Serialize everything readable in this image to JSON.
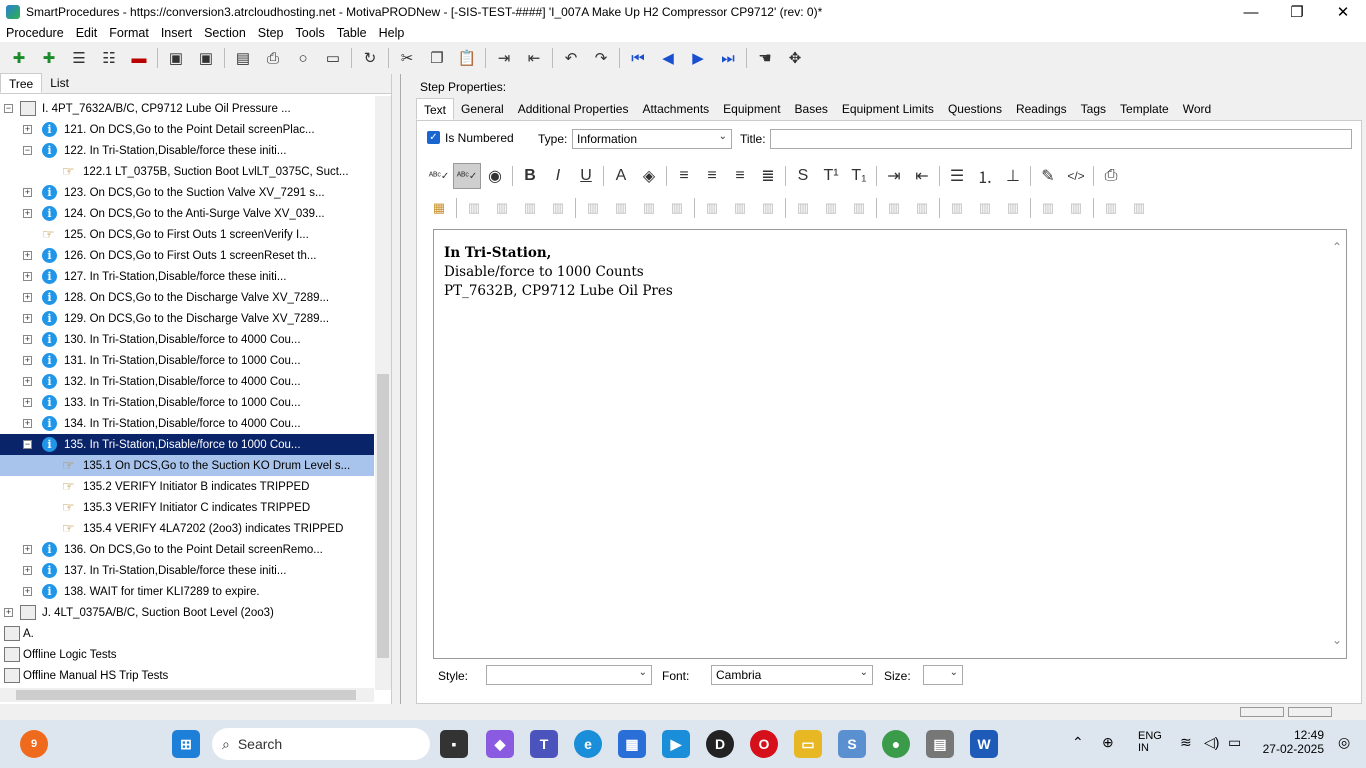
{
  "window": {
    "title": "SmartProcedures - https://conversion3.atrcloudhosting.net - MotivaPRODNew - [-SIS-TEST-####] 'I_007A Make Up H2 Compressor CP9712' (rev: 0)*",
    "min": "—",
    "max": "❐",
    "close": "✕"
  },
  "menu": [
    "Procedure",
    "Edit",
    "Format",
    "Insert",
    "Section",
    "Step",
    "Tools",
    "Table",
    "Help"
  ],
  "toolbar": [
    "add-icon",
    "add-child-icon",
    "list-icon",
    "list2-icon",
    "remove-icon",
    "save-all-icon",
    "save-icon",
    "export-icon",
    "print-icon",
    "refresh-icon",
    "frame-icon",
    "redo-icon",
    "cut-icon",
    "copy-icon",
    "paste-icon",
    "indent-icon",
    "outdent-icon",
    "undo-icon",
    "redo2-icon",
    "first-icon",
    "prev-icon",
    "next-icon",
    "last-icon",
    "hand-icon",
    "move-icon"
  ],
  "left_tabs": {
    "tree": "Tree",
    "list": "List"
  },
  "tree": [
    {
      "label": "I. 4PT_7632A/B/C, CP9712 Lube Oil Pressure ...",
      "lvl": 0,
      "exp": "⊟",
      "icon": "folder"
    },
    {
      "label": "121. On DCS,Go to the Point Detail screenPlac...",
      "lvl": 1,
      "exp": "+",
      "icon": "info"
    },
    {
      "label": "122. In Tri-Station,Disable/force these initi...",
      "lvl": 1,
      "exp": "−",
      "icon": "info"
    },
    {
      "label": "122.1 LT_0375B, Suction Boot LvlLT_0375C, Suct...",
      "lvl": 2,
      "exp": "",
      "icon": "hand"
    },
    {
      "label": "123. On DCS,Go to the Suction Valve XV_7291 s...",
      "lvl": 1,
      "exp": "+",
      "icon": "info"
    },
    {
      "label": "124. On DCS,Go to the Anti-Surge Valve XV_039...",
      "lvl": 1,
      "exp": "+",
      "icon": "info"
    },
    {
      "label": "125. On DCS,Go to First Outs 1 screenVerify I...",
      "lvl": 1,
      "exp": "",
      "icon": "hand"
    },
    {
      "label": "126. On DCS,Go to First Outs 1 screenReset th...",
      "lvl": 1,
      "exp": "+",
      "icon": "info"
    },
    {
      "label": "127. In Tri-Station,Disable/force these initi...",
      "lvl": 1,
      "exp": "+",
      "icon": "info"
    },
    {
      "label": "128. On DCS,Go to the Discharge Valve XV_7289...",
      "lvl": 1,
      "exp": "+",
      "icon": "info"
    },
    {
      "label": "129. On DCS,Go to the Discharge Valve XV_7289...",
      "lvl": 1,
      "exp": "+",
      "icon": "info"
    },
    {
      "label": "130. In Tri-Station,Disable/force to 4000 Cou...",
      "lvl": 1,
      "exp": "+",
      "icon": "info"
    },
    {
      "label": "131. In Tri-Station,Disable/force to 1000 Cou...",
      "lvl": 1,
      "exp": "+",
      "icon": "info"
    },
    {
      "label": "132. In Tri-Station,Disable/force to 4000 Cou...",
      "lvl": 1,
      "exp": "+",
      "icon": "info"
    },
    {
      "label": "133. In Tri-Station,Disable/force to 1000 Cou...",
      "lvl": 1,
      "exp": "+",
      "icon": "info"
    },
    {
      "label": "134. In Tri-Station,Disable/force to 4000 Cou...",
      "lvl": 1,
      "exp": "+",
      "icon": "info"
    },
    {
      "label": "135. In Tri-Station,Disable/force to 1000 Cou...",
      "lvl": 1,
      "exp": "−",
      "icon": "info",
      "state": "selected"
    },
    {
      "label": "135.1 On DCS,Go to the Suction KO Drum Level s...",
      "lvl": 2,
      "exp": "",
      "icon": "hand",
      "state": "sel2"
    },
    {
      "label": "135.2 VERIFY Initiator B indicates TRIPPED",
      "lvl": 2,
      "exp": "",
      "icon": "hand"
    },
    {
      "label": "135.3 VERIFY Initiator C indicates TRIPPED",
      "lvl": 2,
      "exp": "",
      "icon": "hand"
    },
    {
      "label": "135.4 VERIFY 4LA7202 (2oo3) indicates TRIPPED",
      "lvl": 2,
      "exp": "",
      "icon": "hand"
    },
    {
      "label": "136. On DCS,Go to the Point Detail screenRemo...",
      "lvl": 1,
      "exp": "+",
      "icon": "info"
    },
    {
      "label": "137. In Tri-Station,Disable/force these initi...",
      "lvl": 1,
      "exp": "+",
      "icon": "info"
    },
    {
      "label": "138. WAIT for timer KLI7289 to expire.",
      "lvl": 1,
      "exp": "+",
      "icon": "info"
    },
    {
      "label": "J. 4LT_0375A/B/C, Suction Boot Level (2oo3)",
      "lvl": 0,
      "exp": "+",
      "icon": "folder"
    },
    {
      "label": "A.",
      "lvl": -1,
      "exp": "",
      "icon": "folder"
    },
    {
      "label": "Offline Logic Tests",
      "lvl": -1,
      "exp": "",
      "icon": "folder"
    },
    {
      "label": "Offline Manual HS Trip Tests",
      "lvl": -1,
      "exp": "",
      "icon": "folder"
    }
  ],
  "props": {
    "label": "Step Properties:",
    "tabs": [
      "Text",
      "General",
      "Additional Properties",
      "Attachments",
      "Equipment",
      "Bases",
      "Equipment Limits",
      "Questions",
      "Readings",
      "Tags",
      "Template",
      "Word"
    ],
    "is_numbered": "Is Numbered",
    "type_label": "Type:",
    "type_value": "Information",
    "title_label": "Title:",
    "editor_lines": [
      "In Tri-Station,",
      "Disable/force to 1000 Counts",
      "PT_7632B, CP9712 Lube Oil Pres"
    ],
    "style_label": "Style:",
    "style_value": "",
    "font_label": "Font:",
    "font_value": "Cambria",
    "size_label": "Size:",
    "size_value": ""
  },
  "fmt1": [
    "spell-icon",
    "spell-check-icon",
    "web-icon",
    "B",
    "I",
    "U",
    "font-color-icon",
    "fill-color-icon",
    "align-left-icon",
    "align-center-icon",
    "align-right-icon",
    "justify-icon",
    "S",
    "T¹",
    "T₁",
    "indent-icon",
    "outdent-icon",
    "bullets-icon",
    "numbering-icon",
    "insert-line-icon",
    "magic-icon",
    "html-icon",
    "print-icon"
  ],
  "taskbar": {
    "search": "Search",
    "lang1": "ENG",
    "lang2": "IN",
    "time": "12:49",
    "date": "27-02-2025",
    "badge": "9"
  }
}
